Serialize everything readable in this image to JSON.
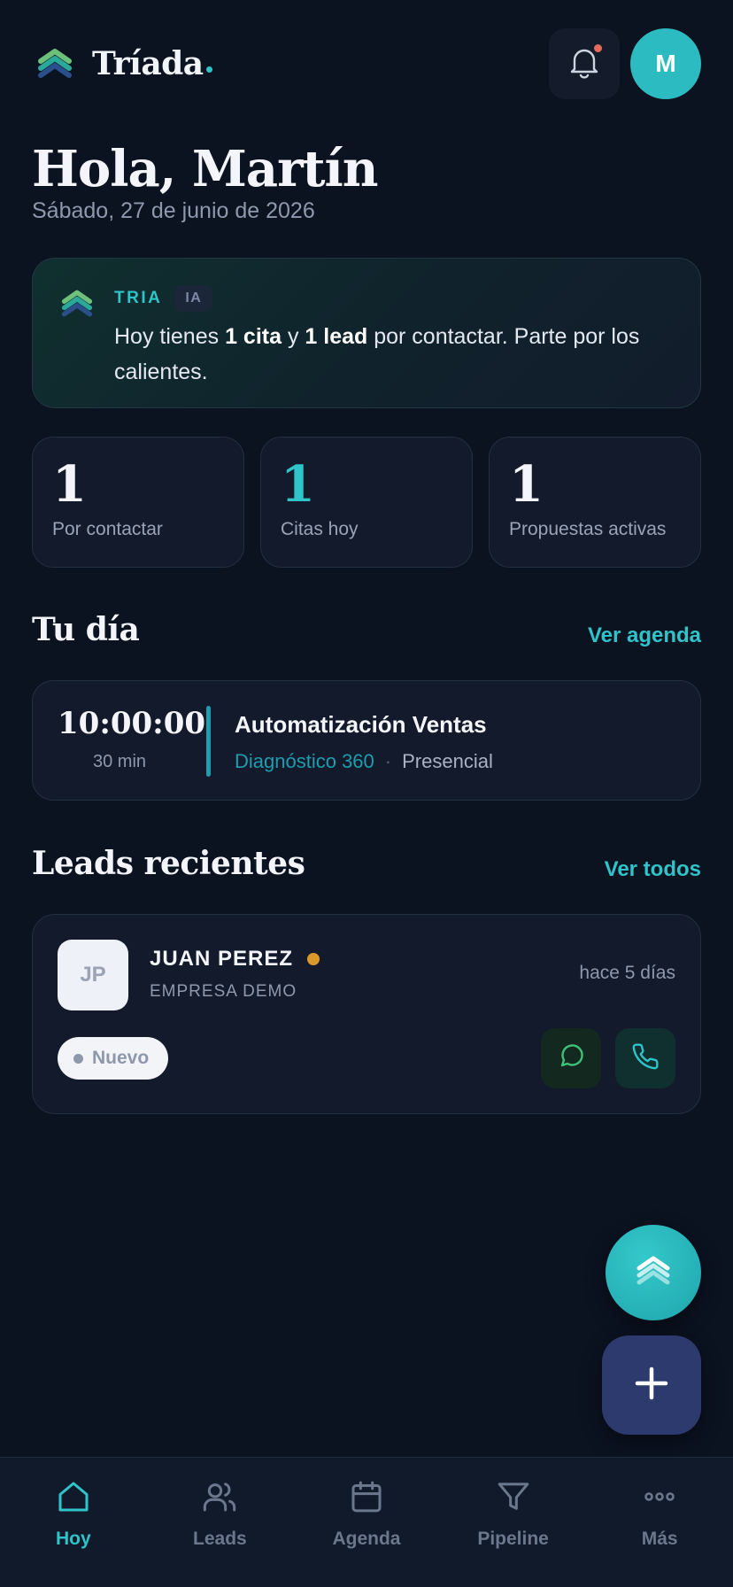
{
  "app": {
    "name": "Tríada",
    "avatar_initial": "M",
    "colors": {
      "accent": "#2fc4c9",
      "background": "#0b1220",
      "card": "#121a2b",
      "hot": "#d99a2b",
      "fab_add": "#2c3a6d"
    }
  },
  "header": {
    "notification_icon": "bell-icon",
    "has_notification": true
  },
  "greeting": {
    "title": "Hola, Martín",
    "date": "Sábado, 27 de junio de 2026"
  },
  "ai_card": {
    "label": "TRIA",
    "badge": "IA",
    "text_parts": [
      "Hoy tienes ",
      "1 cita",
      " y ",
      "1 lead",
      " por contactar. Parte por los calientes."
    ]
  },
  "stats": [
    {
      "value": "1",
      "label": "Por contactar"
    },
    {
      "value": "1",
      "label": "Citas hoy"
    },
    {
      "value": "1",
      "label": "Propuestas activas"
    }
  ],
  "day_section": {
    "title": "Tu día",
    "link": "Ver agenda"
  },
  "appointment": {
    "time": "10:00:00",
    "duration": "30 min",
    "title": "Automatización Ventas",
    "type": "Diagnóstico 360",
    "separator": "·",
    "mode": "Presencial"
  },
  "leads_section": {
    "title": "Leads recientes",
    "link": "Ver todos"
  },
  "lead": {
    "initials": "JP",
    "name": "JUAN PEREZ",
    "company": "EMPRESA DEMO",
    "time_ago": "hace 5 días",
    "status": "Nuevo",
    "actions": [
      "whatsapp-icon",
      "phone-icon"
    ]
  },
  "fabs": {
    "ai": "tria-icon",
    "add": "plus-icon"
  },
  "nav": {
    "items": [
      {
        "label": "Hoy",
        "icon": "home-icon",
        "active": true
      },
      {
        "label": "Leads",
        "icon": "users-icon",
        "active": false
      },
      {
        "label": "Agenda",
        "icon": "calendar-icon",
        "active": false
      },
      {
        "label": "Pipeline",
        "icon": "funnel-icon",
        "active": false
      },
      {
        "label": "Más",
        "icon": "more-icon",
        "active": false
      }
    ]
  }
}
